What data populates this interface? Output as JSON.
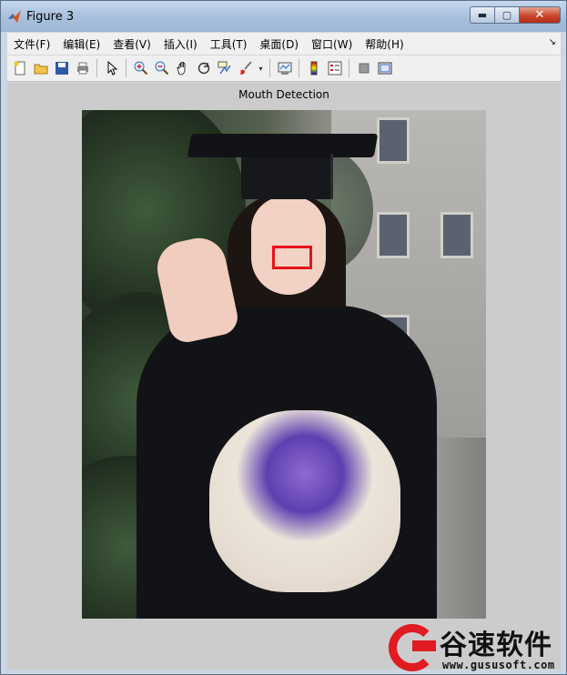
{
  "window": {
    "title": "Figure 3",
    "controls": {
      "minimize": "▬",
      "maximize": "▢",
      "close": "✕"
    }
  },
  "menubar": {
    "items": [
      "文件(F)",
      "编辑(E)",
      "查看(V)",
      "插入(I)",
      "工具(T)",
      "桌面(D)",
      "窗口(W)",
      "帮助(H)"
    ],
    "overflow": "↘"
  },
  "toolbar": {
    "icons": [
      "new-figure-icon",
      "open-file-icon",
      "save-icon",
      "print-icon",
      "select-arrow-icon",
      "zoom-in-icon",
      "zoom-out-icon",
      "pan-hand-icon",
      "rotate-3d-icon",
      "data-cursor-icon",
      "brush-icon",
      "link-plot-icon",
      "colorbar-icon",
      "legend-icon",
      "hide-plot-tools-icon",
      "show-plot-tools-icon"
    ]
  },
  "figure": {
    "axes_title": "Mouth Detection"
  },
  "watermark": {
    "brand": "谷速软件",
    "url": "www.gususoft.com"
  },
  "colors": {
    "detection_box": "#e8121a",
    "figure_bg": "#cccccc",
    "watermark_red": "#e11b22"
  }
}
